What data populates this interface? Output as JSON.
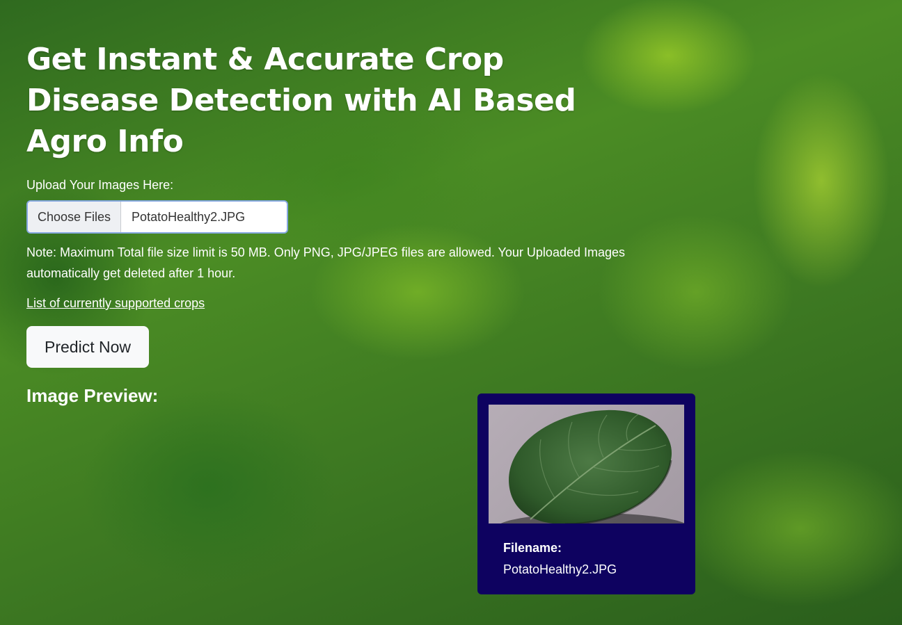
{
  "hero": {
    "title": "Get Instant & Accurate Crop Disease Detection with AI Based Agro Info"
  },
  "upload": {
    "label": "Upload Your Images Here:",
    "button_label": "Choose Files",
    "selected_file": "PotatoHealthy2.JPG",
    "note": "Note: Maximum Total file size limit is 50 MB. Only PNG, JPG/JPEG files are allowed. Your Uploaded Images automatically get deleted after 1 hour."
  },
  "links": {
    "supported_crops": "List of currently supported crops"
  },
  "actions": {
    "predict_label": "Predict Now"
  },
  "preview": {
    "heading": "Image Preview:",
    "cards": [
      {
        "filename_label": "Filename:",
        "filename": "PotatoHealthy2.JPG",
        "image_subject": "green leaf"
      }
    ]
  },
  "colors": {
    "card_background": "#0e0260",
    "button_background": "#f8f9fa",
    "background_foliage": "#4b8c24"
  }
}
